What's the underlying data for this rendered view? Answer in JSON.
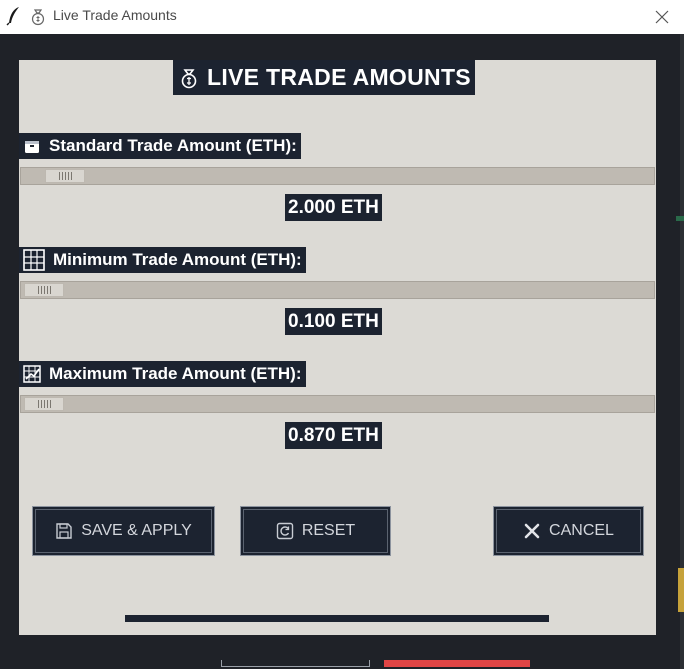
{
  "window": {
    "title": "Live Trade Amounts"
  },
  "icons": {
    "app": "feather-icon",
    "title": "money-bag-icon",
    "close": "close-icon",
    "heading": "money-bag-icon",
    "standard": "box-icon",
    "minimum": "grid-icon",
    "maximum": "chart-icon",
    "save": "floppy-disk-icon",
    "reset": "refresh-icon",
    "cancel": "x-icon"
  },
  "panel": {
    "heading": "LIVE TRADE AMOUNTS"
  },
  "sliders": [
    {
      "label": "Standard Trade Amount (ETH):",
      "value_text": "2.000 ETH",
      "position": 0.04
    },
    {
      "label": "Minimum Trade Amount (ETH):",
      "value_text": "0.100 ETH",
      "position": 0.0
    },
    {
      "label": "Maximum Trade Amount (ETH):",
      "value_text": "0.870 ETH",
      "position": 0.0
    }
  ],
  "buttons": {
    "save": "SAVE & APPLY",
    "reset": "RESET",
    "cancel": "CANCEL"
  },
  "colors": {
    "panel_bg": "#dcdad5",
    "label_bg": "#1c2330",
    "button_bg": "#1c2330",
    "accent_red": "#e04545"
  }
}
